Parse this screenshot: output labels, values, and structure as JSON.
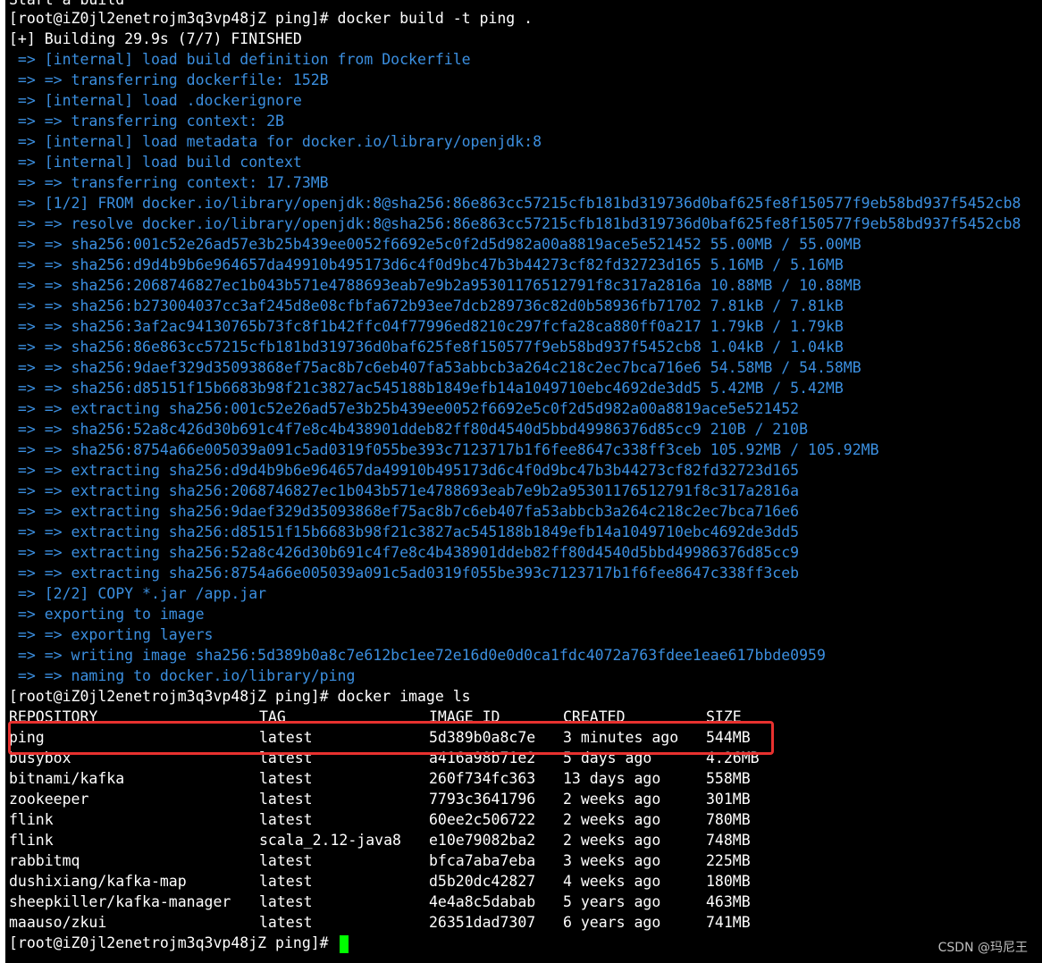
{
  "terminal": {
    "top_line": "Start a build",
    "prompt1": "[root@iZ0jl2enetrojm3q3vp48jZ ping]# docker build -t ping .",
    "building": "[+] Building 29.9s (7/7) FINISHED",
    "build_steps": [
      " => [internal] load build definition from Dockerfile",
      " => => transferring dockerfile: 152B",
      " => [internal] load .dockerignore",
      " => => transferring context: 2B",
      " => [internal] load metadata for docker.io/library/openjdk:8",
      " => [internal] load build context",
      " => => transferring context: 17.73MB",
      " => [1/2] FROM docker.io/library/openjdk:8@sha256:86e863cc57215cfb181bd319736d0baf625fe8f150577f9eb58bd937f5452cb8",
      " => => resolve docker.io/library/openjdk:8@sha256:86e863cc57215cfb181bd319736d0baf625fe8f150577f9eb58bd937f5452cb8",
      " => => sha256:001c52e26ad57e3b25b439ee0052f6692e5c0f2d5d982a00a8819ace5e521452 55.00MB / 55.00MB",
      " => => sha256:d9d4b9b6e964657da49910b495173d6c4f0d9bc47b3b44273cf82fd32723d165 5.16MB / 5.16MB",
      " => => sha256:2068746827ec1b043b571e4788693eab7e9b2a95301176512791f8c317a2816a 10.88MB / 10.88MB",
      " => => sha256:b273004037cc3af245d8e08cfbfa672b93ee7dcb289736c82d0b58936fb71702 7.81kB / 7.81kB",
      " => => sha256:3af2ac94130765b73fc8f1b42ffc04f77996ed8210c297fcfa28ca880ff0a217 1.79kB / 1.79kB",
      " => => sha256:86e863cc57215cfb181bd319736d0baf625fe8f150577f9eb58bd937f5452cb8 1.04kB / 1.04kB",
      " => => sha256:9daef329d35093868ef75ac8b7c6eb407fa53abbcb3a264c218c2ec7bca716e6 54.58MB / 54.58MB",
      " => => sha256:d85151f15b6683b98f21c3827ac545188b1849efb14a1049710ebc4692de3dd5 5.42MB / 5.42MB",
      " => => extracting sha256:001c52e26ad57e3b25b439ee0052f6692e5c0f2d5d982a00a8819ace5e521452",
      " => => sha256:52a8c426d30b691c4f7e8c4b438901ddeb82ff80d4540d5bbd49986376d85cc9 210B / 210B",
      " => => sha256:8754a66e005039a091c5ad0319f055be393c7123717b1f6fee8647c338ff3ceb 105.92MB / 105.92MB",
      " => => extracting sha256:d9d4b9b6e964657da49910b495173d6c4f0d9bc47b3b44273cf82fd32723d165",
      " => => extracting sha256:2068746827ec1b043b571e4788693eab7e9b2a95301176512791f8c317a2816a",
      " => => extracting sha256:9daef329d35093868ef75ac8b7c6eb407fa53abbcb3a264c218c2ec7bca716e6",
      " => => extracting sha256:d85151f15b6683b98f21c3827ac545188b1849efb14a1049710ebc4692de3dd5",
      " => => extracting sha256:52a8c426d30b691c4f7e8c4b438901ddeb82ff80d4540d5bbd49986376d85cc9",
      " => => extracting sha256:8754a66e005039a091c5ad0319f055be393c7123717b1f6fee8647c338ff3ceb",
      " => [2/2] COPY *.jar /app.jar",
      " => exporting to image",
      " => => exporting layers",
      " => => writing image sha256:5d389b0a8c7e612bc1ee72e16d0e0d0ca1fdc4072a763fdee1eae617bbde0959",
      " => => naming to docker.io/library/ping"
    ],
    "prompt2": "[root@iZ0jl2enetrojm3q3vp48jZ ping]# docker image ls",
    "table_headers": [
      "REPOSITORY",
      "TAG",
      "IMAGE ID",
      "CREATED",
      "SIZE"
    ],
    "table_rows": [
      [
        "ping",
        "latest",
        "5d389b0a8c7e",
        "3 minutes ago",
        "544MB"
      ],
      [
        "busybox",
        "latest",
        "a416a98b71e2",
        "5 days ago",
        "4.26MB"
      ],
      [
        "bitnami/kafka",
        "latest",
        "260f734fc363",
        "13 days ago",
        "558MB"
      ],
      [
        "zookeeper",
        "latest",
        "7793c3641796",
        "2 weeks ago",
        "301MB"
      ],
      [
        "flink",
        "latest",
        "60ee2c506722",
        "2 weeks ago",
        "780MB"
      ],
      [
        "flink",
        "scala_2.12-java8",
        "e10e79082ba2",
        "2 weeks ago",
        "748MB"
      ],
      [
        "rabbitmq",
        "latest",
        "bfca7aba7eba",
        "3 weeks ago",
        "225MB"
      ],
      [
        "dushixiang/kafka-map",
        "latest",
        "d5b20dc42827",
        "4 weeks ago",
        "180MB"
      ],
      [
        "sheepkiller/kafka-manager",
        "latest",
        "4e4a8c5dabab",
        "5 years ago",
        "463MB"
      ],
      [
        "maauso/zkui",
        "latest",
        "26351dad7307",
        "6 years ago",
        "741MB"
      ]
    ],
    "prompt3": "[root@iZ0jl2enetrojm3q3vp48jZ ping]# "
  },
  "watermark": "CSDN @玛尼王",
  "colors": {
    "background": "#000000",
    "text": "#ffffff",
    "build_step": "#3b8fe0",
    "highlight_border": "#e8312f",
    "cursor": "#00ff00"
  }
}
